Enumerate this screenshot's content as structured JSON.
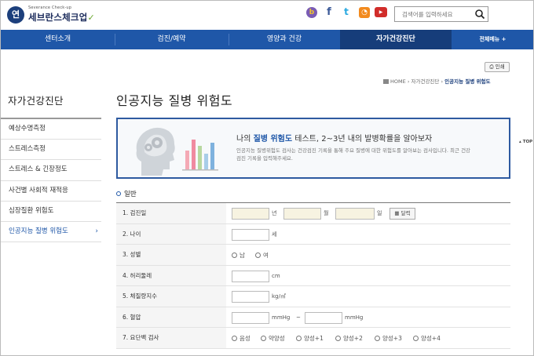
{
  "header": {
    "logo_sub": "Severance Check-up",
    "logo_main": "세브란스체크업",
    "logo_emblem": "연",
    "sns": [
      "blog-icon",
      "facebook-icon",
      "twitter-icon",
      "rss-icon",
      "youtube-icon"
    ],
    "search": {
      "placeholder": "검색어를 입력하세요"
    }
  },
  "nav": {
    "items": [
      "센터소개",
      "검진/예약",
      "영양과 건강",
      "자가건강진단"
    ],
    "all_menu": "전체메뉴 +"
  },
  "utility": {
    "print_label": "인쇄",
    "breadcrumb": {
      "home": "HOME",
      "sep": "›",
      "parent": "자가건강진단",
      "current": "인공지능 질병 위험도"
    }
  },
  "sidebar": {
    "title": "자가건강진단",
    "items": [
      {
        "label": "예상수명측정"
      },
      {
        "label": "스트레스측정"
      },
      {
        "label": "스트레스 & 긴장정도"
      },
      {
        "label": "사건별 사회적 재적응"
      },
      {
        "label": "심장질환 위험도"
      },
      {
        "label": "인공지능 질병 위험도",
        "active": true
      }
    ],
    "active_arrow": "›"
  },
  "main": {
    "title": "인공지능 질병 위험도",
    "banner": {
      "head_pre": "나의 ",
      "head_em": "질병 위험도",
      "head_post": " 테스트, 2~3년 내의 발병확률을 알아보자",
      "desc": "인공지능 질병위험도 검사는 건강검진 기록을 통해 주요 질병에 대한 위험도를 알아보는 검사입니다. 최근 건강검진 기록을 입력해주세요."
    },
    "top_label": "TOP",
    "section_title": "일반",
    "form": {
      "rows": [
        {
          "label": "1. 검진일",
          "year": "년",
          "month": "월",
          "day": "일",
          "calendar": "달력"
        },
        {
          "label": "2. 나이",
          "unit": "세"
        },
        {
          "label": "3. 성별",
          "options": [
            "남",
            "여"
          ]
        },
        {
          "label": "4. 허리둘레",
          "unit": "cm"
        },
        {
          "label": "5. 체질량지수",
          "unit": "kg/㎡"
        },
        {
          "label": "6. 혈압",
          "unit1": "mmHg",
          "tilde": "~",
          "unit2": "mmHg"
        },
        {
          "label": "7. 요단백 검사",
          "options": [
            "음성",
            "약양성",
            "양성+1",
            "양성+2",
            "양성+3",
            "양성+4"
          ]
        }
      ]
    }
  },
  "colors": {
    "nav": "#1f57a8",
    "nav_active": "#163d7a",
    "accent": "#1f57a8",
    "banner_border": "#2e5aa0",
    "input_shade": "#f7f3e1"
  }
}
